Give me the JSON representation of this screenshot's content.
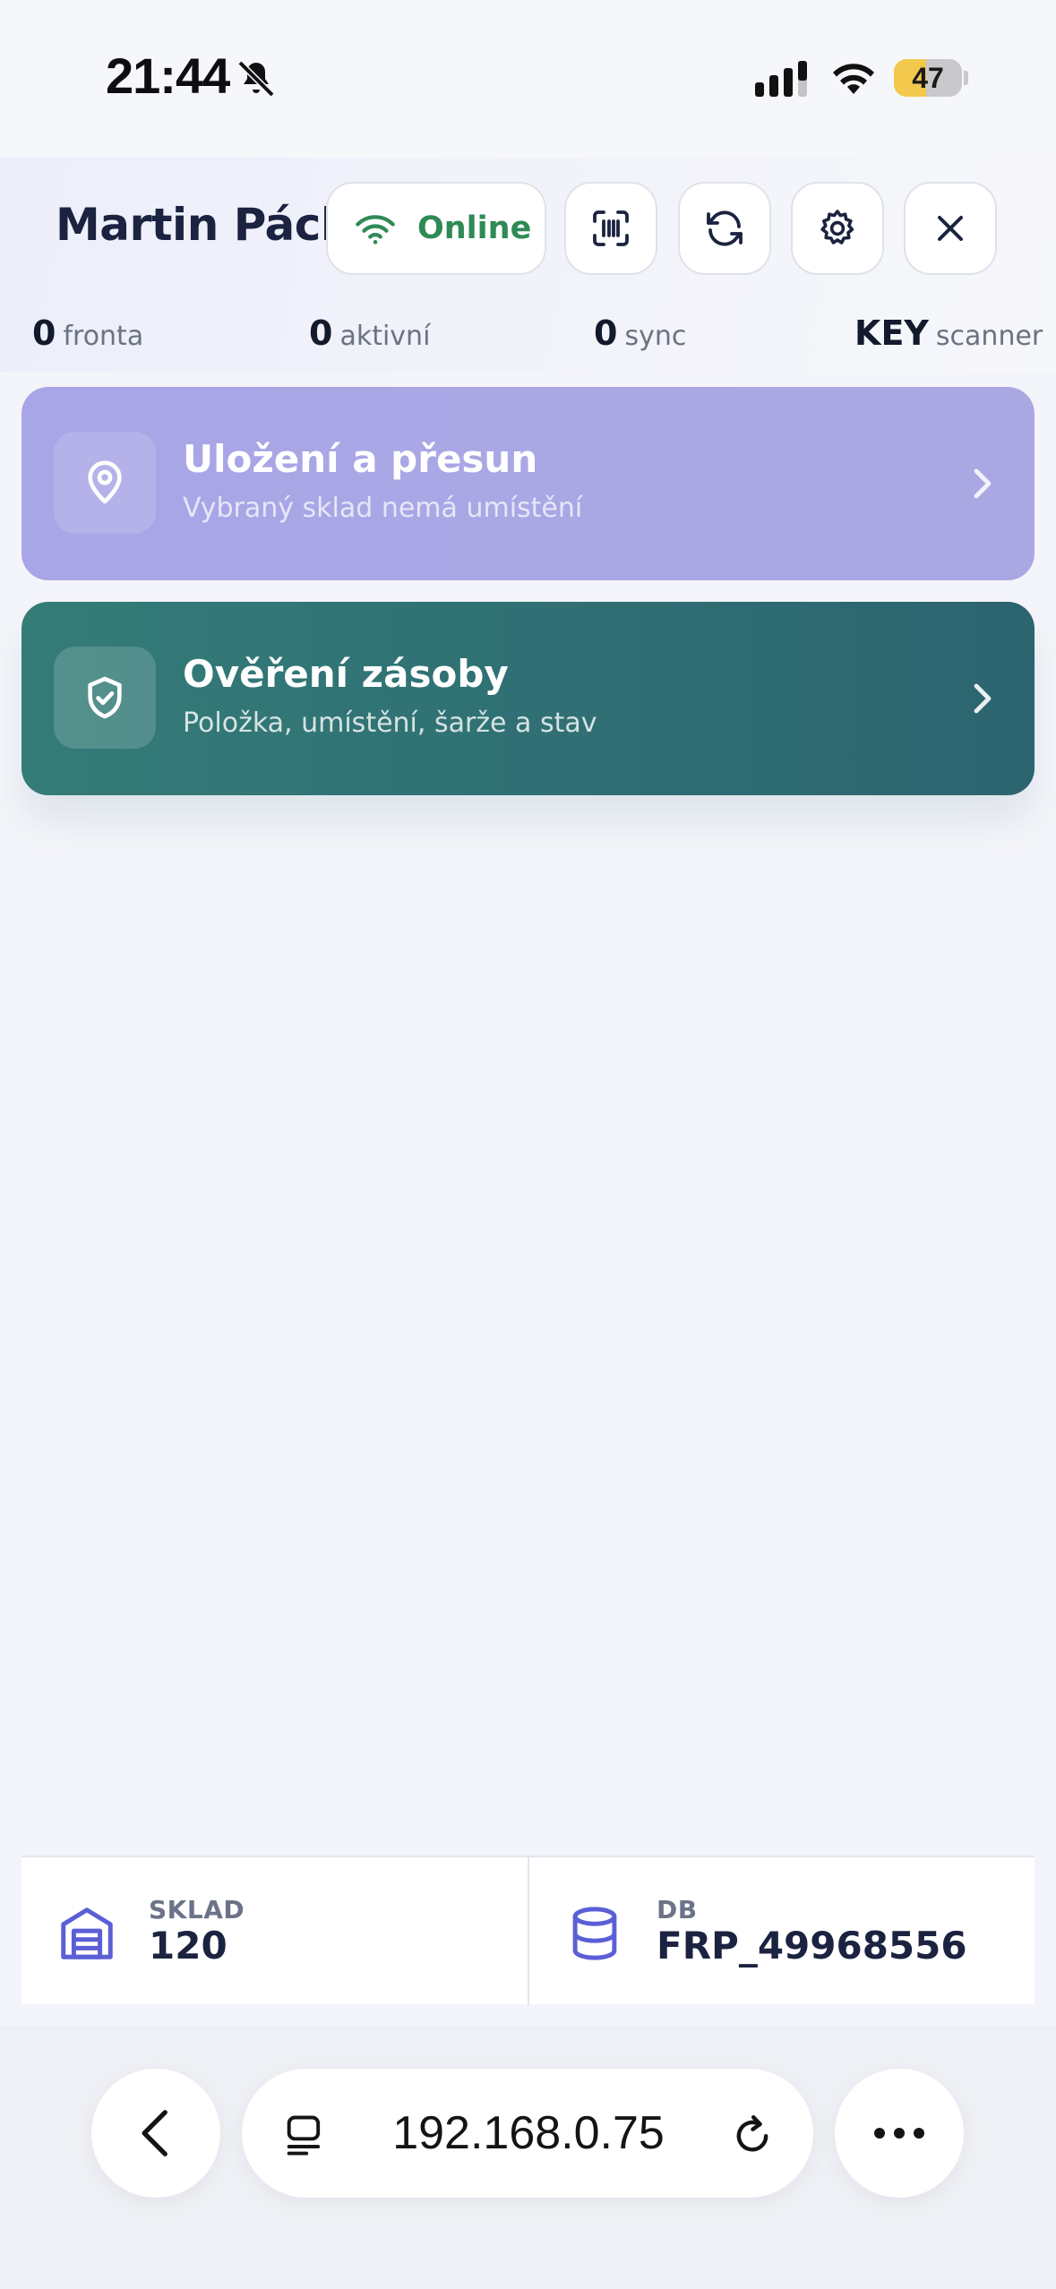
{
  "status_bar": {
    "time": "21:44",
    "battery": "47",
    "battery_level": 0.47,
    "icons": [
      "bell-slash-icon",
      "cellular-signal-icon",
      "wifi-icon",
      "battery-icon"
    ]
  },
  "header": {
    "user_name": "Martin Pácl",
    "connection_status": "Online",
    "connection_color": "#2f8a55",
    "buttons": [
      "barcode-scan-icon",
      "sync-icon",
      "settings-gear-icon",
      "close-icon"
    ]
  },
  "stats": {
    "queue": {
      "value": "0",
      "label": "fronta"
    },
    "active": {
      "value": "0",
      "label": "aktivní"
    },
    "sync": {
      "value": "0",
      "label": "sync"
    },
    "input": {
      "value": "KEY",
      "label": "scanner"
    }
  },
  "cards": [
    {
      "title": "Uložení a přesun",
      "subtitle": "Vybraný sklad nemá umístění",
      "icon": "location-pin-icon",
      "color": "#a9a7e5"
    },
    {
      "title": "Ověření zásoby",
      "subtitle": "Položka, umístění, šarže a stav",
      "icon": "shield-check-icon",
      "color": "#307276"
    }
  ],
  "info": {
    "warehouse": {
      "label": "SKLAD",
      "value": "120",
      "icon": "warehouse-icon"
    },
    "database": {
      "label": "DB",
      "value": "FRP_49968556",
      "icon": "database-icon"
    },
    "accent": "#5b5fd6"
  },
  "browser": {
    "url": "192.168.0.75",
    "icons": [
      "back-chevron-icon",
      "tabs-icon",
      "reload-icon",
      "more-icon"
    ]
  }
}
